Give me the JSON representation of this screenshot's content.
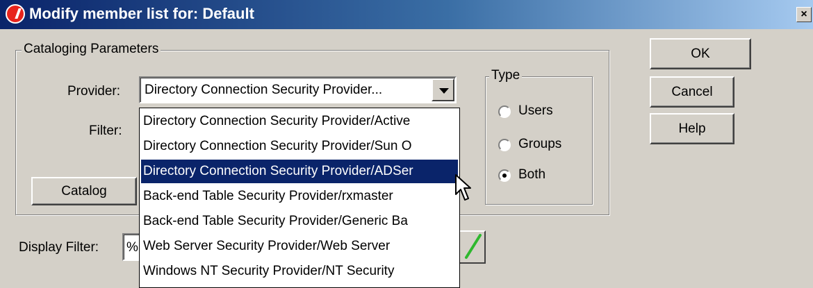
{
  "window": {
    "title": "Modify member list for: Default",
    "close_label": "×"
  },
  "buttons": {
    "ok": "OK",
    "cancel": "Cancel",
    "help": "Help",
    "catalog": "Catalog"
  },
  "cataloging": {
    "legend": "Cataloging Parameters",
    "provider_label": "Provider:",
    "provider_value": "Directory Connection Security Provider...",
    "filter_label": "Filter:"
  },
  "type": {
    "legend": "Type",
    "options": [
      {
        "label": "Users",
        "checked": false
      },
      {
        "label": "Groups",
        "checked": false
      },
      {
        "label": "Both",
        "checked": true
      }
    ]
  },
  "provider_list": [
    "Directory Connection Security Provider/Active",
    "Directory Connection Security Provider/Sun O",
    "Directory Connection Security Provider/ADSer",
    "Back-end Table Security Provider/rxmaster",
    "Back-end Table Security Provider/Generic Ba",
    "Web Server Security Provider/Web Server",
    "Windows NT Security Provider/NT Security"
  ],
  "selected_provider_index": 2,
  "display_filter": {
    "label": "Display Filter:",
    "value": "%"
  },
  "icons": {
    "apply": "green-checkmark-icon",
    "app": "app-logo-icon",
    "pointer": "mouse-pointer-icon"
  },
  "colors": {
    "title_gradient_start": "#0a246a",
    "selection": "#0a246a",
    "checkmark": "#2eb82e"
  }
}
